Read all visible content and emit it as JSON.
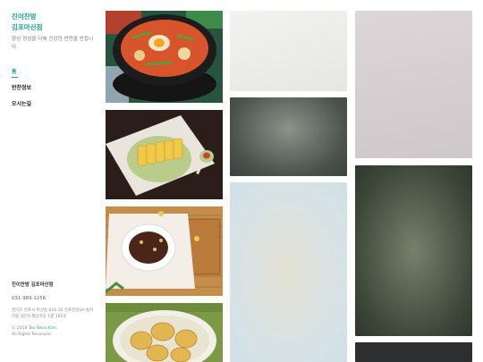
{
  "sidebar": {
    "brand_line1": "진이찬방",
    "brand_line2": "김포마산점",
    "tagline": "항상 정성을 다해 건강한 반찬을 만듭니다.",
    "nav": [
      {
        "label": "홈"
      },
      {
        "label": "반찬정보"
      },
      {
        "label": "오시는길"
      }
    ],
    "footer": {
      "name": "진이찬방 김포마산점",
      "phone": "031-989-1256",
      "address": "경기도 김포시 마산동 616-10 김포한강LH 솔터마을 3단지 제상가동 1층 102호",
      "copyright_prefix": "© 2018 ",
      "author": "Tae Geun Kim",
      "copyright_suffix": ".",
      "rights": "All Rights Reserved."
    }
  },
  "gallery": {
    "photos": [
      {
        "icon": "stew-pot-photo"
      },
      {
        "icon": "egg-roll-photo"
      },
      {
        "icon": "braised-beef-photo"
      },
      {
        "icon": "pancake-photo"
      }
    ]
  },
  "colors": {
    "accent": "#1f9f8c"
  }
}
